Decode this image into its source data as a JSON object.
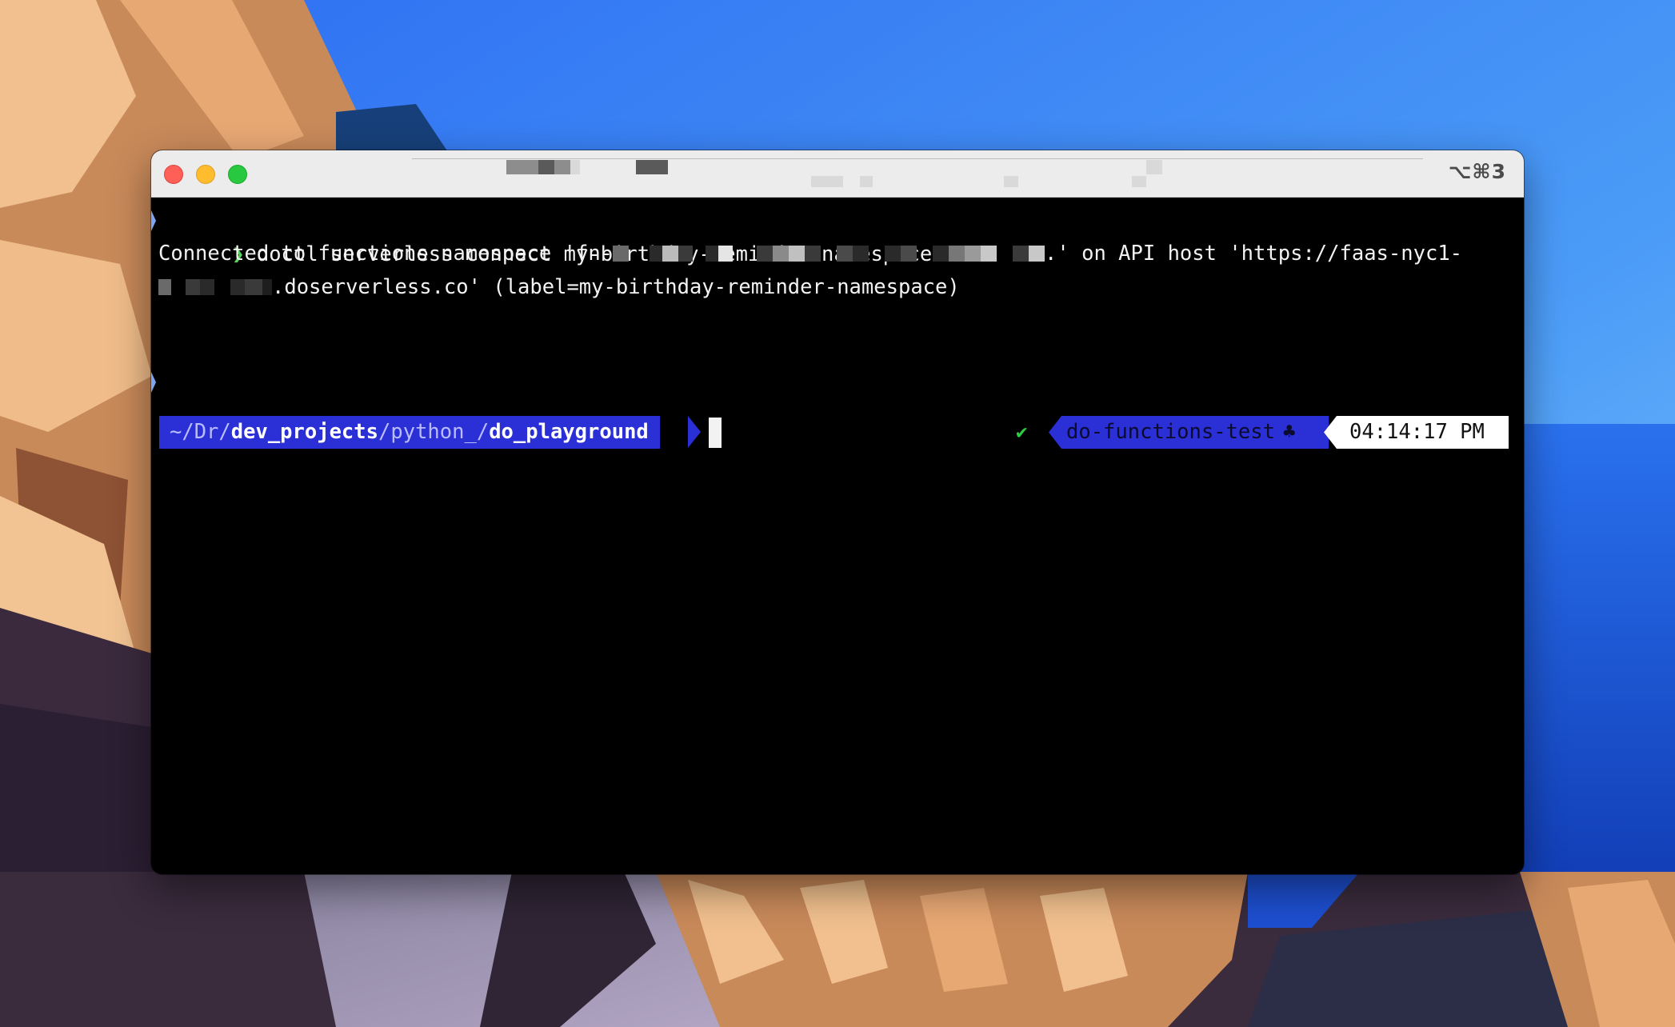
{
  "window": {
    "shortcut": "⌥⌘3"
  },
  "terminal": {
    "line1": {
      "prompt": "❯",
      "command": "doctl serverless connect my-birthday-reminder-namespace"
    },
    "line2": {
      "prefix": "Connected to functions namespace 'fn-",
      "suffix": ".' on API host 'https://faas-nyc1-"
    },
    "line3": {
      "suffix": ".doserverless.co' (label=my-birthday-reminder-namespace)"
    },
    "prompt": {
      "path_prefix": "~/Dr/",
      "path_seg1": "dev_projects",
      "path_sep1": "/",
      "path_seg2": "python_",
      "path_sep2": "/",
      "path_seg3": "do_playground",
      "status_icon": "✔",
      "environment": "do-functions-test",
      "environment_icon": "♣",
      "time": "04:14:17 PM"
    }
  },
  "colors": {
    "terminal_bg": "#000000",
    "prompt_green": "#5ad35a",
    "powerline_blue": "#2a2fd6",
    "status_green": "#2ecc40"
  }
}
